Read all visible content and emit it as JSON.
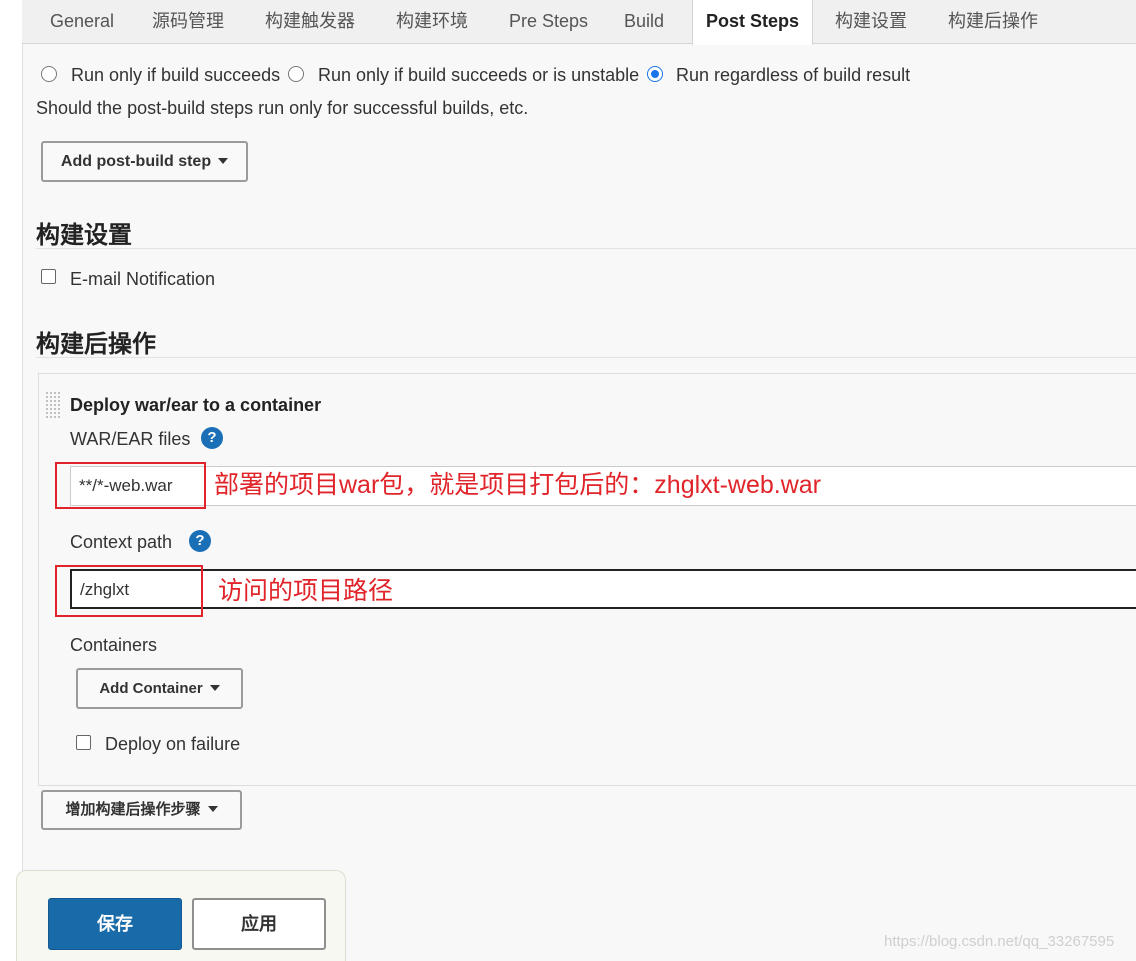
{
  "tabs": [
    {
      "label": "General"
    },
    {
      "label": "源码管理"
    },
    {
      "label": "构建触发器"
    },
    {
      "label": "构建环境"
    },
    {
      "label": "Pre Steps"
    },
    {
      "label": "Build"
    },
    {
      "label": "Post Steps",
      "active": true
    },
    {
      "label": "构建设置"
    },
    {
      "label": "构建后操作"
    }
  ],
  "post_steps": {
    "options": [
      {
        "label": "Run only if build succeeds",
        "checked": false
      },
      {
        "label": "Run only if build succeeds or is unstable",
        "checked": false
      },
      {
        "label": "Run regardless of build result",
        "checked": true
      }
    ],
    "description": "Should the post-build steps run only for successful builds, etc.",
    "add_button": "Add post-build step"
  },
  "build_settings": {
    "title": "构建设置",
    "email_label": "E-mail Notification",
    "email_checked": false
  },
  "post_build": {
    "title": "构建后操作",
    "deploy": {
      "title": "Deploy war/ear to a container",
      "war_label": "WAR/EAR files",
      "war_value": "**/*-web.war",
      "context_label": "Context path",
      "context_value": "/zhglxt",
      "containers_label": "Containers",
      "add_container": "Add Container",
      "deploy_failure_label": "Deploy on failure",
      "deploy_failure_checked": false
    },
    "add_step_button": "增加构建后操作步骤"
  },
  "annotations": {
    "war_note": "部署的项目war包，就是项目打包后的：zhglxt-web.war",
    "context_note": "访问的项目路径"
  },
  "actions": {
    "save": "保存",
    "apply": "应用"
  },
  "watermark": "https://blog.csdn.net/qq_33267595",
  "colors": {
    "accent": "#1a73e8",
    "primary_button": "#186aa8",
    "help_icon": "#1b6fb7",
    "annotation_red": "#e0242a"
  },
  "icons": {
    "help": "question-circle-icon",
    "caret": "caret-down-icon",
    "drag": "drag-handle-icon"
  }
}
